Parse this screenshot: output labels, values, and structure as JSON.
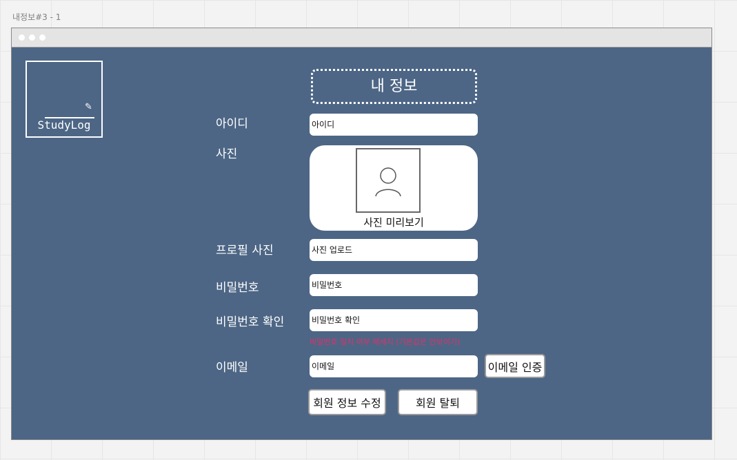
{
  "frame_label": "내정보#3 - 1",
  "logo": {
    "text": "StudyLog",
    "icon": "pencil-icon"
  },
  "page_title": "내 정보",
  "form": {
    "id_label": "아이디",
    "id_placeholder": "아이디",
    "photo_label": "사진",
    "photo_preview_caption": "사진 미리보기",
    "profile_photo_label": "프로필 사진",
    "upload_placeholder": "사진 업로드",
    "password_label": "비밀번호",
    "password_placeholder": "비밀번호",
    "password_confirm_label": "비밀번호 확인",
    "password_confirm_placeholder": "비밀번호 확인",
    "password_match_message": "비밀번호 일치 여부 메세지 (기본값은 안보이기)",
    "email_label": "이메일",
    "email_placeholder": "이메일",
    "email_verify_button": "이메일 인증"
  },
  "actions": {
    "edit_button": "회원 정보 수정",
    "withdraw_button": "회원 탈퇴"
  },
  "colors": {
    "window_bg": "#4d6685",
    "hint_text": "#e0306b"
  }
}
